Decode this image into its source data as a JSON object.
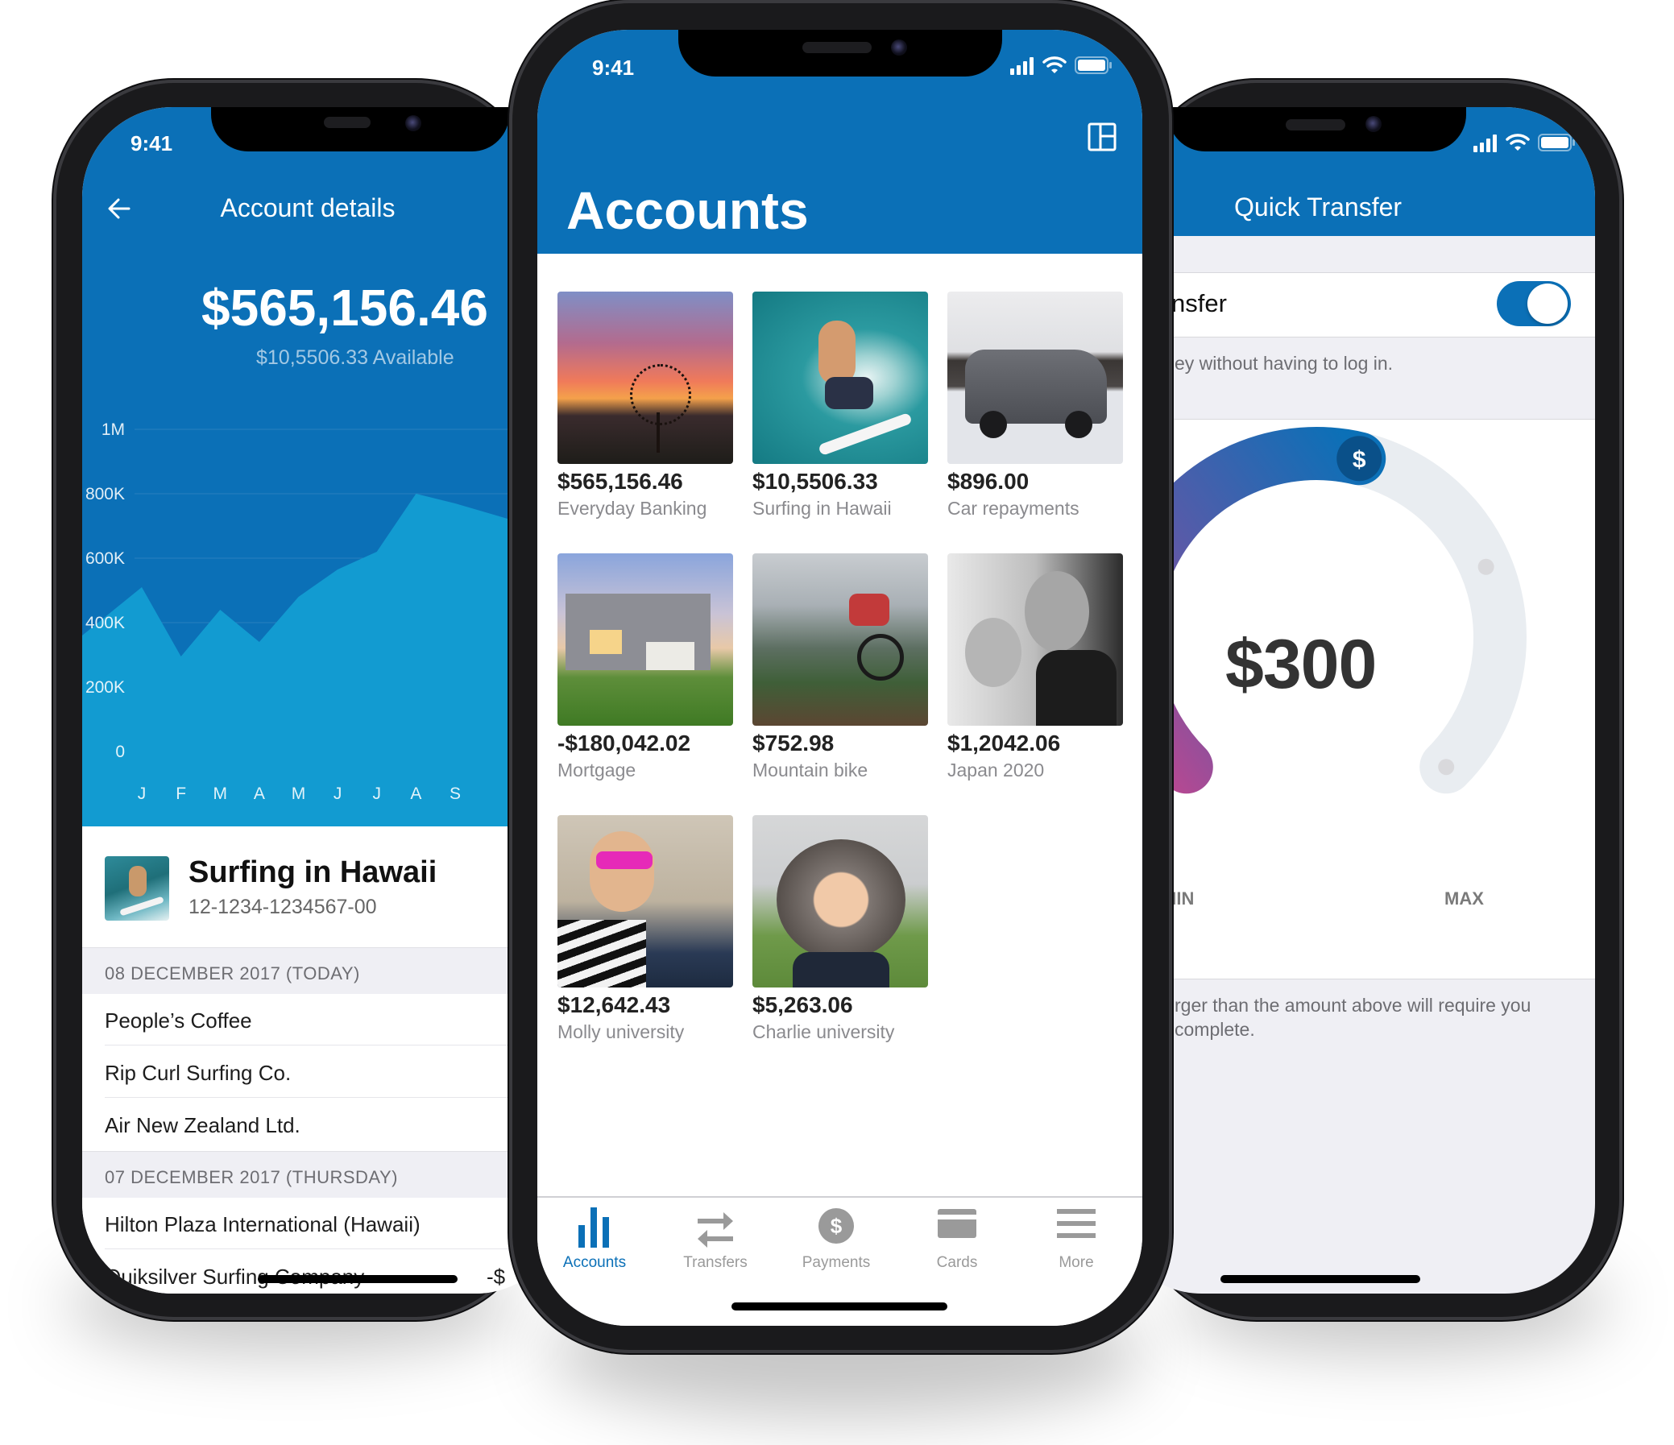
{
  "status_bar": {
    "time": "9:41"
  },
  "account_details": {
    "title": "Account details",
    "back_icon": "arrow-left-icon",
    "balance": "$565,156.46",
    "available": "$10,5506.33 Available",
    "account": {
      "name": "Surfing in Hawaii",
      "number": "12-1234-1234567-00",
      "thumbnail": "surfer-photo"
    },
    "sections": [
      {
        "header": "08 DECEMBER 2017 (TODAY)",
        "transactions": [
          {
            "name": "People’s Coffee",
            "amount": ""
          },
          {
            "name": "Rip Curl Surfing Co.",
            "amount": "-"
          },
          {
            "name": "Air New Zealand Ltd.",
            "amount": "-"
          }
        ]
      },
      {
        "header": "07 DECEMBER 2017 (THURSDAY)",
        "transactions": [
          {
            "name": "Hilton Plaza International (Hawaii)",
            "amount": ""
          },
          {
            "name": "Quiksilver Surfing Company",
            "amount": "-$"
          }
        ]
      }
    ]
  },
  "chart_data": {
    "type": "area",
    "title": "",
    "xlabel": "",
    "ylabel": "",
    "categories": [
      "J",
      "F",
      "M",
      "A",
      "M",
      "J",
      "J",
      "A",
      "S"
    ],
    "values": [
      510000,
      295000,
      440000,
      340000,
      480000,
      565000,
      620000,
      800000,
      770000
    ],
    "y_ticks": [
      "1M",
      "800K",
      "600K",
      "400K",
      "200K",
      "0"
    ],
    "ylim": [
      0,
      1000000
    ],
    "grid": true,
    "colors": {
      "background": "#0b70b7",
      "fill": "#129bd1"
    }
  },
  "accounts": {
    "title": "Accounts",
    "layout_icon": "layout-grid-icon",
    "items": [
      {
        "amount": "$565,156.46",
        "label": "Everyday Banking",
        "image": "sunset-tree"
      },
      {
        "amount": "$10,5506.33",
        "label": "Surfing in Hawaii",
        "image": "surfer"
      },
      {
        "amount": "$896.00",
        "label": "Car repayments",
        "image": "grey-suv"
      },
      {
        "amount": "-$180,042.02",
        "label": "Mortgage",
        "image": "house"
      },
      {
        "amount": "$752.98",
        "label": "Mountain bike",
        "image": "mountain-biker"
      },
      {
        "amount": "$1,2042.06",
        "label": "Japan 2020",
        "image": "couple-selfie"
      },
      {
        "amount": "$12,642.43",
        "label": "Molly university",
        "image": "girl-sunglasses"
      },
      {
        "amount": "$5,263.06",
        "label": "Charlie university",
        "image": "boy-fur-hood"
      }
    ],
    "tabs": [
      {
        "label": "Accounts",
        "icon": "bar-chart-icon",
        "active": true
      },
      {
        "label": "Transfers",
        "icon": "transfer-arrows-icon",
        "active": false
      },
      {
        "label": "Payments",
        "icon": "dollar-circle-icon",
        "active": false
      },
      {
        "label": "Cards",
        "icon": "card-icon",
        "active": false
      },
      {
        "label": "More",
        "icon": "menu-icon",
        "active": false
      }
    ]
  },
  "quick_transfer": {
    "title": "Quick Transfer",
    "toggle_label": "nsfer",
    "toggle_on": true,
    "toggle_description": "ey without having to log in.",
    "amount": "$300",
    "min_label": "MIN",
    "max_label": "MAX",
    "slider_value_fraction": 0.55,
    "footer_text_line1": "rger than the amount above will require you",
    "footer_text_line2": "complete.",
    "accent": "#0b70b7"
  }
}
